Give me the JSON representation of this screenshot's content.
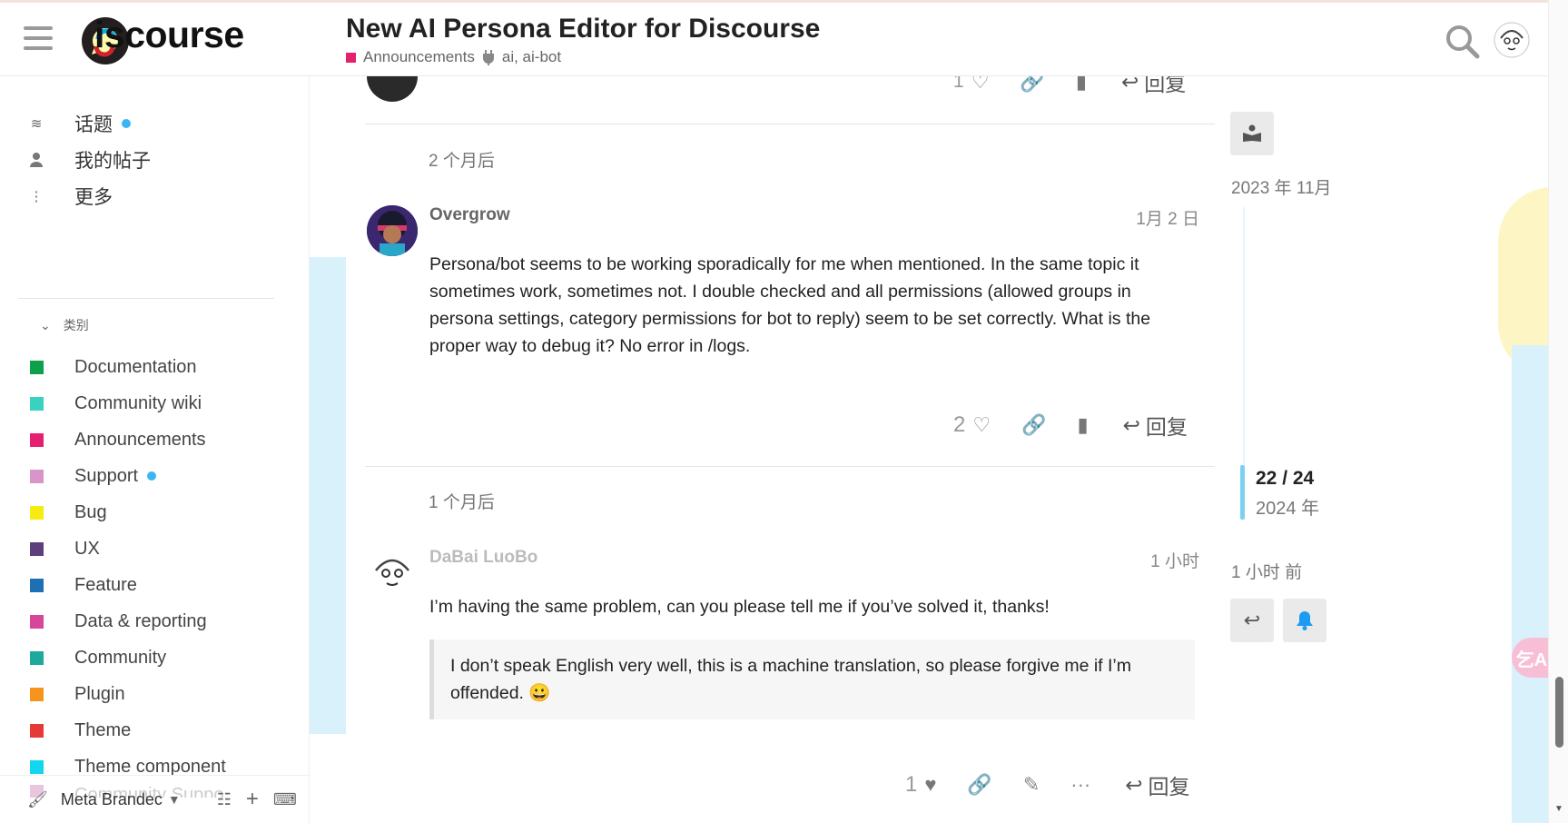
{
  "header": {
    "logo_text": "iscourse",
    "topic_title": "New AI Persona Editor for Discourse",
    "category": "Announcements",
    "category_color": "#e5206f",
    "tags": "ai, ai-bot"
  },
  "sidebar": {
    "nav": [
      {
        "label": "话题",
        "icon": "layers-icon",
        "unread": true
      },
      {
        "label": "我的帖子",
        "icon": "user-icon",
        "unread": false
      },
      {
        "label": "更多",
        "icon": "more-vertical-icon",
        "unread": false
      }
    ],
    "categories_header": "类别",
    "categories": [
      {
        "label": "Documentation",
        "color": "#0da04b"
      },
      {
        "label": "Community wiki",
        "color": "#3ad1c1"
      },
      {
        "label": "Announcements",
        "color": "#e5206f"
      },
      {
        "label": "Support",
        "color": "#d895c8",
        "unread": true
      },
      {
        "label": "Bug",
        "color": "#f6ec13"
      },
      {
        "label": "UX",
        "color": "#5e3e7c"
      },
      {
        "label": "Feature",
        "color": "#1f6fb5"
      },
      {
        "label": "Data & reporting",
        "color": "#d6479a"
      },
      {
        "label": "Community",
        "color": "#1fa99a"
      },
      {
        "label": "Plugin",
        "color": "#f7941d"
      },
      {
        "label": "Theme",
        "color": "#e53a36"
      },
      {
        "label": "Theme component",
        "color": "#12d6ef"
      }
    ],
    "partial_item": "Community Suppo",
    "footer": {
      "theme_label": "Meta Brandec"
    }
  },
  "stream": {
    "top_post": {
      "likes": "1",
      "reply_label": "回复"
    },
    "gap1": "2 个月后",
    "post1": {
      "username": "Overgrow",
      "date": "1月 2 日",
      "body": "Persona/bot seems to be working sporadically for me when mentioned. In the same topic it sometimes work, sometimes not. I double checked and all permissions (allowed groups in persona settings, category permissions for bot to reply) seem to be set correctly. What is the proper way to debug it? No error in /logs.",
      "likes": "2",
      "reply_label": "回复"
    },
    "gap2": "1 个月后",
    "post2": {
      "username": "DaBai LuoBo",
      "date": "1 小时",
      "body": "I’m having the same problem, can you please tell me if you’ve solved it, thanks!",
      "quote": "I don’t speak English very well, this is a machine translation, so please forgive me if I’m offended. 😀",
      "likes": "1",
      "reply_label": "回复"
    }
  },
  "timeline": {
    "start_date": "2023 年 11月",
    "position": "22 / 24",
    "position_year": "2024 年",
    "end_label": "1 小时 前"
  },
  "translate_label": "乞A"
}
